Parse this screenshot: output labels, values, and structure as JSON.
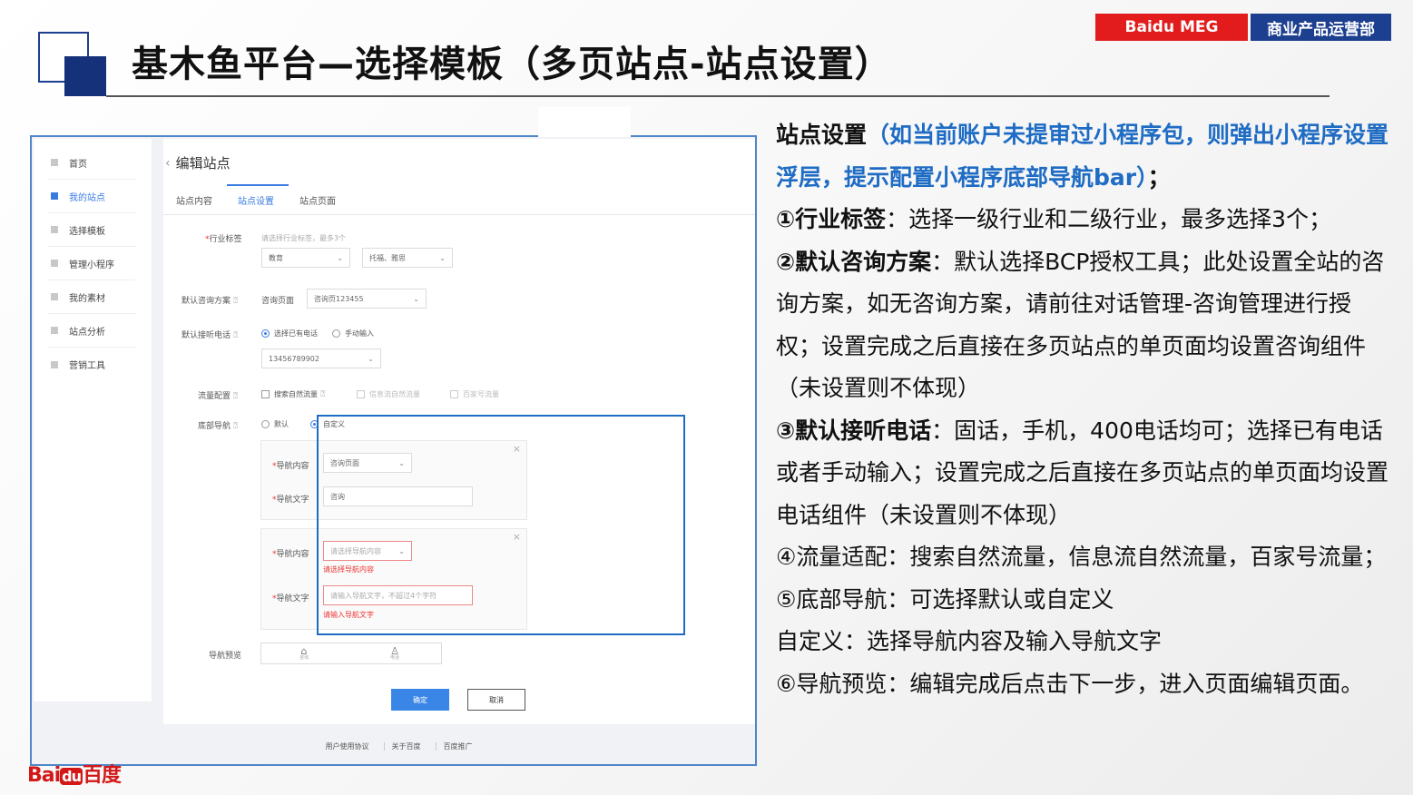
{
  "slide": {
    "title": "基木鱼平台—选择模板（多页站点-站点设置）",
    "badge_brand": "Baidu MEG",
    "badge_dept": "商业产品运营部",
    "bottom_logo": "Bai du 百度",
    "colors": {
      "brand_red": "#e21c1c",
      "navy": "#1d3f8f",
      "accent_blue": "#1f6cc4",
      "link_blue": "#3a7be0"
    }
  },
  "sidebar": {
    "items": [
      {
        "label": "首页",
        "active": false
      },
      {
        "label": "我的站点",
        "active": true
      },
      {
        "label": "选择模板",
        "active": false
      },
      {
        "label": "管理小程序",
        "active": false
      },
      {
        "label": "我的素材",
        "active": false
      },
      {
        "label": "站点分析",
        "active": false
      },
      {
        "label": "营销工具",
        "active": false
      }
    ]
  },
  "page": {
    "back_icon": "chevron-left-icon",
    "title": "编辑站点",
    "tabs": [
      {
        "label": "站点内容",
        "active": false
      },
      {
        "label": "站点设置",
        "active": true
      },
      {
        "label": "站点页面",
        "active": false
      }
    ]
  },
  "form": {
    "industry": {
      "label": "行业标签",
      "hint": "请选择行业标签，最多3个",
      "primary_value": "教育",
      "secondary_value": "托福、雅思"
    },
    "consult": {
      "label": "默认咨询方案",
      "prefix": "咨询页面",
      "value": "咨询页123455"
    },
    "phone": {
      "label": "默认接听电话",
      "option_existing": "选择已有电话",
      "option_manual": "手动输入",
      "value": "13456789902"
    },
    "traffic": {
      "label": "流量配置",
      "option_search": "搜索自然流量",
      "option_feed": "信息流自然流量",
      "option_baijiahao": "百家号流量"
    },
    "bottom_nav": {
      "label": "底部导航",
      "option_default": "默认",
      "option_custom": "自定义",
      "card1": {
        "content_label": "导航内容",
        "content_value": "咨询页面",
        "text_label": "导航文字",
        "text_value": "咨询"
      },
      "card2": {
        "content_label": "导航内容",
        "content_placeholder": "请选择导航内容",
        "content_error": "请选择导航内容",
        "text_label": "导航文字",
        "text_placeholder": "请输入导航文字，不超过4个字符",
        "text_error": "请输入导航文字"
      }
    },
    "preview": {
      "label": "导航预览",
      "icons": [
        "home-icon",
        "user-icon"
      ]
    },
    "buttons": {
      "confirm": "确定",
      "cancel": "取消"
    }
  },
  "footer": {
    "links": [
      "用户使用协议",
      "关于百度",
      "百度推广"
    ]
  },
  "description": {
    "heading": "站点设置",
    "heading_note": "（如当前账户未提审过小程序包，则弹出小程序设置浮层，提示配置小程序底部导航bar）",
    "heading_tail": "；",
    "item1_bold": "①行业标签",
    "item1_text": "：选择一级行业和二级行业，最多选择3个；",
    "item2_bold": "②默认咨询方案",
    "item2_text": "：默认选择BCP授权工具；此处设置全站的咨询方案，如无咨询方案，请前往对话管理-咨询管理进行授权；设置完成之后直接在多页站点的单页面均设置咨询组件（未设置则不体现）",
    "item3_bold": "③默认接听电话",
    "item3_text": "：固话，手机，400电话均可；选择已有电话或者手动输入；设置完成之后直接在多页站点的单页面均设置电话组件（未设置则不体现）",
    "item4": "④流量适配：搜索自然流量，信息流自然流量，百家号流量；",
    "item5": "⑤底部导航：可选择默认或自定义",
    "item5_sub": "自定义：选择导航内容及输入导航文字",
    "item6": "⑥导航预览：编辑完成后点击下一步，进入页面编辑页面。"
  }
}
